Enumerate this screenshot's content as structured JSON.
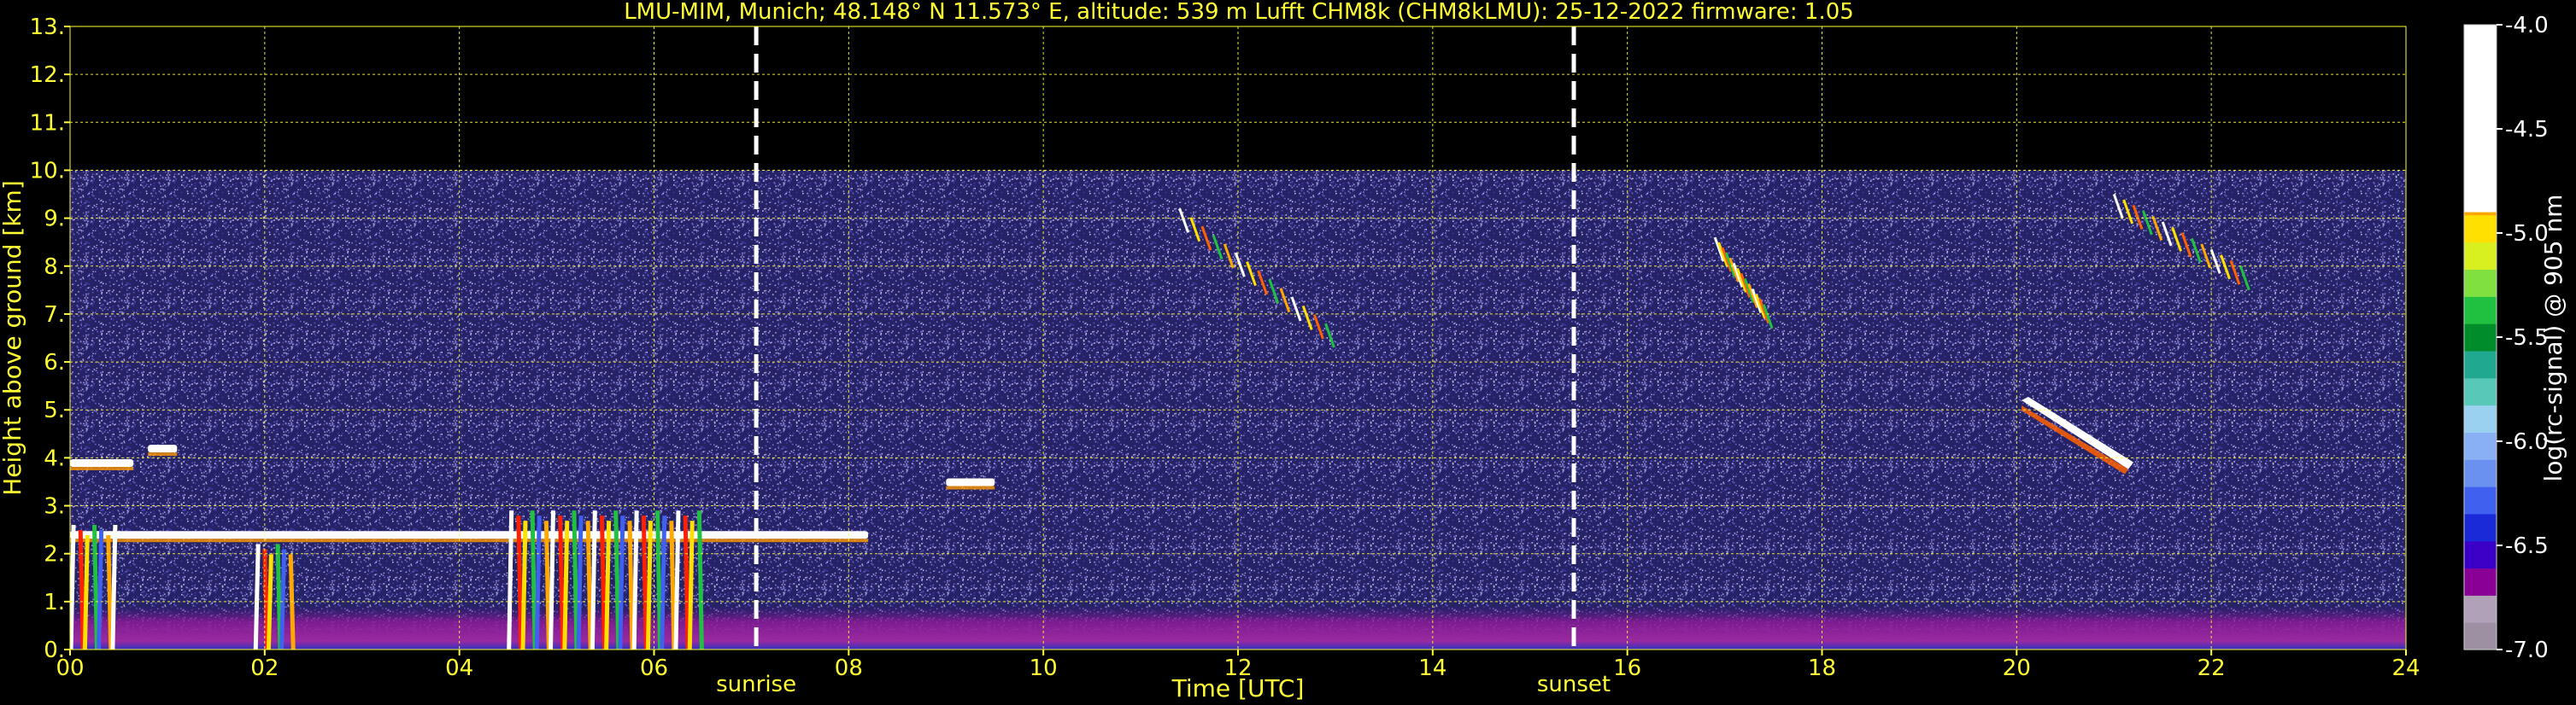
{
  "chart_data": {
    "type": "heatmap",
    "title": "LMU-MIM, Munich; 48.148° N 11.573° E, altitude: 539 m    Lufft CHM8k (CHM8kLMU): 25-12-2022    firmware: 1.05",
    "xlabel": "Time [UTC]",
    "ylabel": "Height above ground [km]",
    "xlim": [
      0,
      24
    ],
    "ylim": [
      0,
      13
    ],
    "x_ticks": [
      "00",
      "02",
      "04",
      "06",
      "08",
      "10",
      "12",
      "14",
      "16",
      "18",
      "20",
      "22",
      "24"
    ],
    "y_ticks": [
      "0.",
      "1.",
      "2.",
      "3.",
      "4.",
      "5.",
      "6.",
      "7.",
      "8.",
      "9.",
      "10.",
      "11.",
      "12.",
      "13."
    ],
    "grid": true,
    "signal_top_km": 10,
    "events": [
      {
        "label": "sunrise",
        "time": 7.05
      },
      {
        "label": "sunset",
        "time": 15.45
      }
    ],
    "colorbar": {
      "label": "log(rc-signal) @ 905 nm",
      "range": [
        -7.0,
        -4.0
      ],
      "ticks": [
        "-4.0",
        "-4.5",
        "-5.0",
        "-5.5",
        "-6.0",
        "-6.5",
        "-7.0"
      ],
      "colors": [
        "#9c90a2",
        "#b0a0b8",
        "#8a0096",
        "#3a00c8",
        "#1a2ad8",
        "#4060f0",
        "#6a90f0",
        "#8ab0f4",
        "#9ad0f0",
        "#58c8b8",
        "#20a890",
        "#008c2a",
        "#20c040",
        "#80e040",
        "#d8f020",
        "#ffe000",
        "#ffa800",
        "#ff6000",
        "#ff2000",
        "#ee0000",
        "#e6b4b4",
        "#e8dede",
        "#ffffff"
      ]
    },
    "features": [
      {
        "kind": "boundary_layer",
        "from": 0,
        "to": 24,
        "top_km": 0.9
      },
      {
        "kind": "low_cloud",
        "from": 0,
        "to": 8.2,
        "height_km": 2.4
      },
      {
        "kind": "precipitation",
        "from": 0,
        "to": 0.5,
        "from_km": 0,
        "to_km": 2.6
      },
      {
        "kind": "precipitation",
        "from": 1.9,
        "to": 2.3,
        "from_km": 0,
        "to_km": 2.2
      },
      {
        "kind": "precipitation",
        "from": 4.5,
        "to": 6.5,
        "from_km": 0,
        "to_km": 2.9
      },
      {
        "kind": "cloud",
        "from": 0,
        "to": 0.65,
        "height_km": 3.9
      },
      {
        "kind": "cloud",
        "from": 0.8,
        "to": 1.1,
        "height_km": 4.2
      },
      {
        "kind": "cloud",
        "from": 9.0,
        "to": 9.5,
        "height_km": 3.5
      },
      {
        "kind": "cirrus",
        "from": 11.4,
        "to": 12.9,
        "from_km": 6.8,
        "to_km": 9.2
      },
      {
        "kind": "cirrus",
        "from": 16.9,
        "to": 17.4,
        "from_km": 7.2,
        "to_km": 8.6
      },
      {
        "kind": "cloud",
        "from": 20.05,
        "to": 21.2,
        "from_km": 3.8,
        "to_km": 5.2
      },
      {
        "kind": "cirrus",
        "from": 21.0,
        "to": 22.3,
        "from_km": 8.0,
        "to_km": 9.5
      }
    ]
  }
}
